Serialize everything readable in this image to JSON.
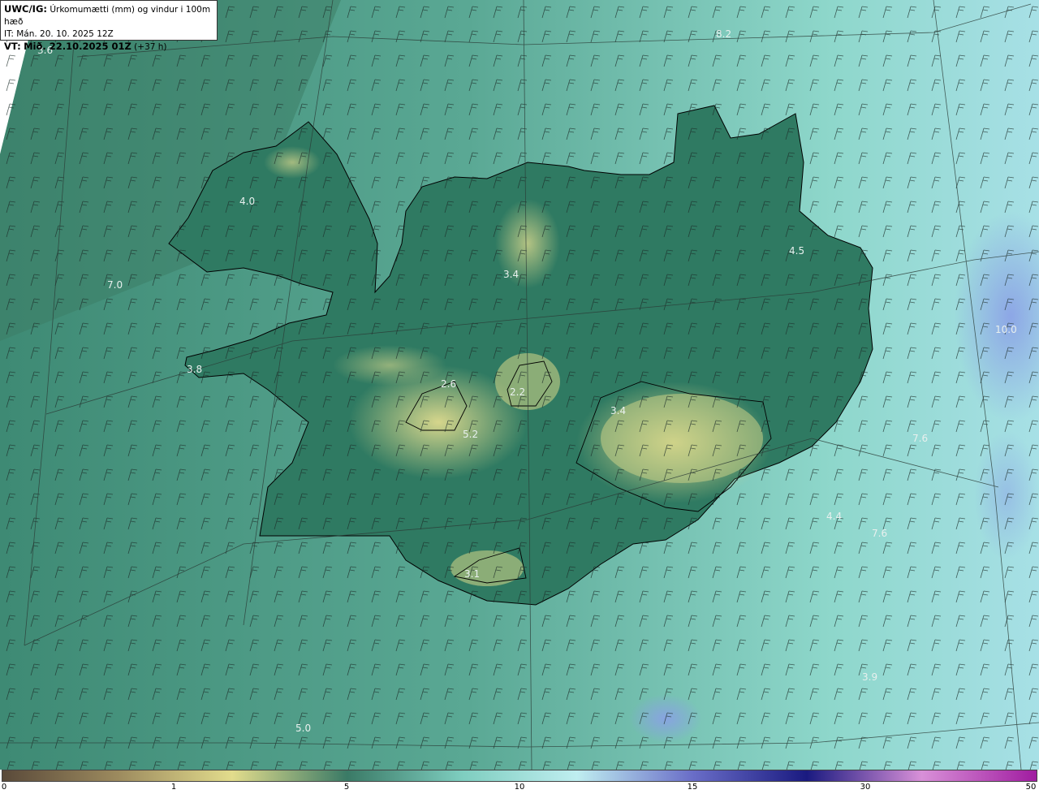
{
  "header": {
    "model": "UWC/IG:",
    "title": "Úrkomumætti (mm) og vindur i 100m hæð",
    "initial_time": "IT: Mán. 20. 10. 2025 12Z",
    "valid_prefix": "VT:",
    "valid_time": "Mið. 22.10.2025 01Z",
    "lead": "(+37 h)"
  },
  "value_labels": [
    "3.6",
    "8.2",
    "4.0",
    "7.0",
    "3.4",
    "4.5",
    "3.8",
    "2.6",
    "2.2",
    "3.4",
    "5.2",
    "7.6",
    "4.4",
    "7.6",
    "10.0",
    "3.1",
    "3.9",
    "5.0"
  ],
  "colorbar": {
    "ticks": [
      "0",
      "1",
      "5",
      "10",
      "15",
      "30",
      "50"
    ],
    "colors": [
      "#5a4a3a",
      "#9c8a5e",
      "#e2dc8c",
      "#3a7a66",
      "#7ecdbf",
      "#bfeef0",
      "#6a6ec8",
      "#1a1a80",
      "#d890d8",
      "#a01ca0"
    ]
  },
  "colors": {
    "sea": "#5fb0a0",
    "land_low": "#2f7a62",
    "land_high": "#c9cf86",
    "coast": "#000000"
  }
}
